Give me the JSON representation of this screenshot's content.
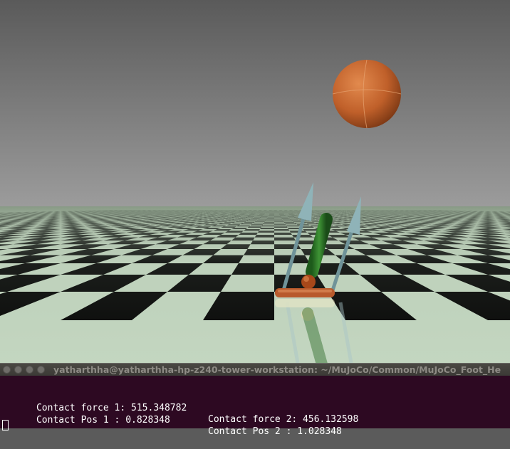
{
  "terminal": {
    "title": "yatharthha@yatharthha-hp-z240-tower-workstation: ~/MuJoCo/Common/MuJoCo_Foot_He",
    "lines": [
      {
        "left": "Contact force 1: 515.348782",
        "right": "Contact force 2: 456.132598"
      },
      {
        "left": "Contact Pos 1 : 0.828348",
        "right": "Contact Pos 2 : 1.028348"
      }
    ]
  },
  "scene": {
    "sky_color": "#9a9a9a",
    "ball_color": "#c0602a",
    "link_color": "#2f7a2a",
    "foot_color": "#b85a2c",
    "arrow_color": "#7a9ea4",
    "floor_light": "#c3d6c0",
    "floor_dark": "#050505"
  }
}
